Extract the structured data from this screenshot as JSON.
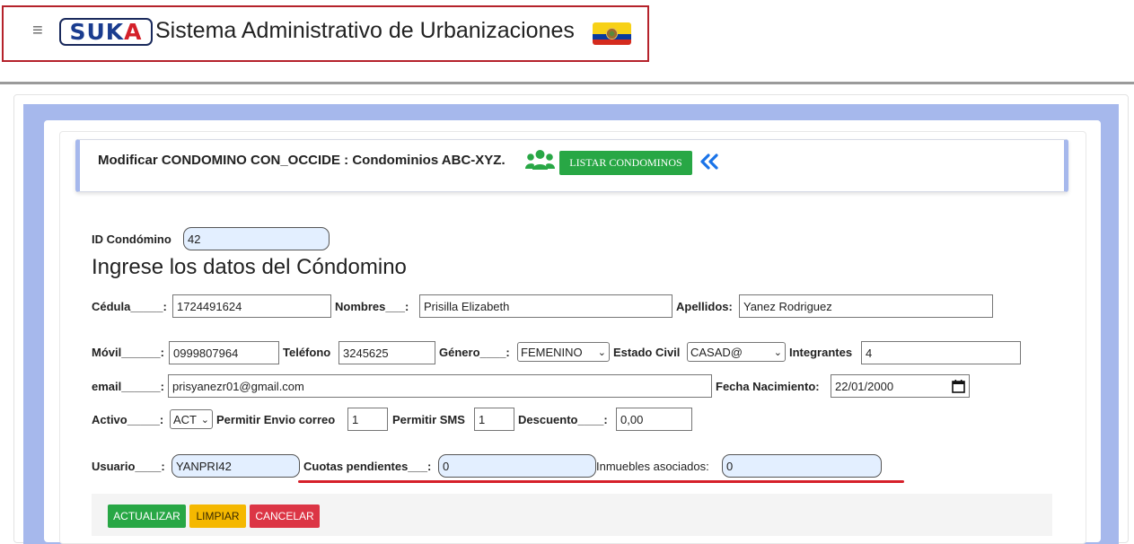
{
  "header": {
    "menu_icon": "hamburger-icon",
    "logo": {
      "part1": "SUK",
      "part2": "A"
    },
    "title": "Sistema Administrativo de Urbanizaciones",
    "flag": "ecuador-flag"
  },
  "section": {
    "heading": "Modificar CONDOMINO CON_OCCIDE : Condominios ABC-XYZ.",
    "users_icon": "users-icon",
    "list_button": "LISTAR CONDOMINOS",
    "back_icon": "double-chevron-left-icon"
  },
  "form": {
    "id_label": "ID Condómino",
    "id_value": "42",
    "title": "Ingrese los datos del Cóndomino",
    "cedula_label": "Cédula_____:",
    "cedula": "1724491624",
    "nombres_label": "Nombres___:",
    "nombres": "Prisilla Elizabeth",
    "apellidos_label": "Apellidos:",
    "apellidos": "Yanez Rodriguez",
    "movil_label": "Móvil______:",
    "movil": "0999807964",
    "telefono_label": "Teléfono",
    "telefono": "3245625",
    "genero_label": "Género____:",
    "genero": "FEMENINO",
    "estado_label": "Estado Civil",
    "estado": "CASAD@",
    "integrantes_label": "Integrantes",
    "integrantes": "4",
    "email_label": "email______:",
    "email": "prisyanezr01@gmail.com",
    "fecha_label": "Fecha Nacimiento:",
    "fecha": "22/01/2000",
    "activo_label": "Activo_____:",
    "activo": "ACT",
    "envio_label": "Permitir Envio correo",
    "envio": "1",
    "sms_label": "Permitir SMS",
    "sms": "1",
    "descuento_label": "Descuento____:",
    "descuento": "0,00",
    "usuario_label": "Usuario____:",
    "usuario": "YANPRI42",
    "cuotas_label": "Cuotas pendientes___:",
    "cuotas": "0",
    "inmuebles_label": "Inmuebles asociados:",
    "inmuebles": "0"
  },
  "actions": {
    "update": "ACTUALIZAR",
    "clear": "LIMPIAR",
    "cancel": "CANCELAR"
  },
  "colors": {
    "accent_blue": "#a6b8ec",
    "green": "#28a745",
    "yellow": "#f5b800",
    "red": "#dc3545",
    "highlight_red": "#b5222b"
  }
}
